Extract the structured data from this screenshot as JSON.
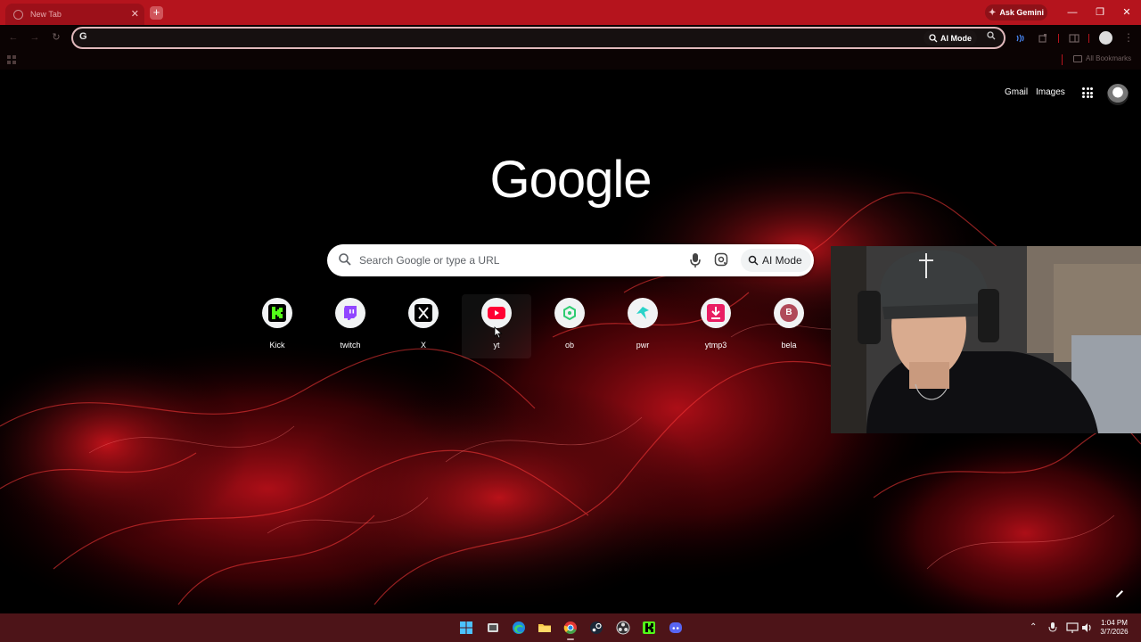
{
  "browser": {
    "tab_title": "New Tab",
    "gemini_label": "Ask Gemini",
    "omnibox": {
      "ai_mode_label": "AI Mode",
      "value": ""
    },
    "bookmarks_all_label": "All Bookmarks"
  },
  "google": {
    "logo_text": "Google",
    "header_links": [
      "Gmail",
      "Images"
    ],
    "search_placeholder": "Search Google or type a URL",
    "ai_mode_label": "AI Mode"
  },
  "shortcuts": [
    {
      "label": "Kick",
      "icon": "kick-icon",
      "color": "#53fc18"
    },
    {
      "label": "twitch",
      "icon": "twitch-icon",
      "color": "#9146ff"
    },
    {
      "label": "X",
      "icon": "x-icon",
      "color": "#000000"
    },
    {
      "label": "yt",
      "icon": "youtube-icon",
      "color": "#ff0033"
    },
    {
      "label": "ob",
      "icon": "ob-icon",
      "color": "#2ecc71"
    },
    {
      "label": "pwr",
      "icon": "pwr-icon",
      "color": "#2ad3c9"
    },
    {
      "label": "ytmp3",
      "icon": "download-icon",
      "color": "#e91e63"
    },
    {
      "label": "bela",
      "icon": "letter-b-icon",
      "color": "#b04a5a",
      "letter": "B"
    }
  ],
  "taskbar": {
    "time": "1:04 PM",
    "date": "3/7/2026"
  },
  "colors": {
    "accent": "#b5141d",
    "taskbar": "#4d1418"
  }
}
